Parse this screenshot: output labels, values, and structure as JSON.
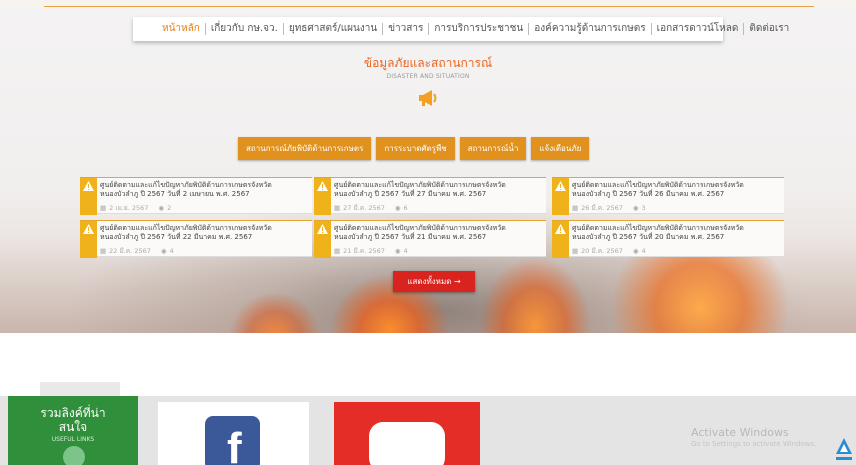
{
  "nav": {
    "items": [
      "หน้าหลัก",
      "เกี่ยวกับ กษ.จว.",
      "ยุทธศาสตร์/แผนงาน",
      "ข่าวสาร",
      "การบริการประชาชน",
      "องค์ความรู้ด้านการเกษตร",
      "เอกสารดาวน์โหลด",
      "ติดต่อเรา"
    ]
  },
  "section": {
    "title": "ข้อมูลภัยและสถานการณ์",
    "subtitle": "DISASTER AND SITUATION"
  },
  "tabs": [
    "สถานการณ์ภัยพิบัติด้านการเกษตร",
    "การระบาดศัตรูพืช",
    "สถานการณ์น้ำ",
    "แจ้งเตือนภัย"
  ],
  "cards": [
    {
      "line1": "ศูนย์ติดตามและแก้ไขปัญหาภัยพิบัติด้านการเกษตรจังหวัด",
      "line2": "หนองบัวลำภู ปี 2567 วันที่ 2 เมษายน พ.ศ. 2567",
      "date": "2 เม.ย. 2567",
      "views": "2"
    },
    {
      "line1": "ศูนย์ติดตามและแก้ไขปัญหาภัยพิบัติด้านการเกษตรจังหวัด",
      "line2": "หนองบัวลำภู ปี 2567 วันที่ 27 มีนาคม พ.ศ. 2567",
      "date": "27 มี.ค. 2567",
      "views": "6"
    },
    {
      "line1": "ศูนย์ติดตามและแก้ไขปัญหาภัยพิบัติด้านการเกษตรจังหวัด",
      "line2": "หนองบัวลำภู ปี 2567 วันที่ 26 มีนาคม พ.ศ. 2567",
      "date": "26 มี.ค. 2567",
      "views": "3"
    },
    {
      "line1": "ศูนย์ติดตามและแก้ไขปัญหาภัยพิบัติด้านการเกษตรจังหวัด",
      "line2": "หนองบัวลำภู ปี 2567 วันที่ 22 มีนาคม พ.ศ. 2567",
      "date": "22 มี.ค. 2567",
      "views": "4"
    },
    {
      "line1": "ศูนย์ติดตามและแก้ไขปัญหาภัยพิบัติด้านการเกษตรจังหวัด",
      "line2": "หนองบัวลำภู ปี 2567 วันที่ 21 มีนาคม พ.ศ. 2567",
      "date": "21 มี.ค. 2567",
      "views": "4"
    },
    {
      "line1": "ศูนย์ติดตามและแก้ไขปัญหาภัยพิบัติด้านการเกษตรจังหวัด",
      "line2": "หนองบัวลำภู ปี 2567 วันที่ 20 มีนาคม พ.ศ. 2567",
      "date": "20 มี.ค. 2567",
      "views": "4"
    }
  ],
  "show_all": "แสดงทั้งหมด →",
  "links": {
    "title_line1": "รวมลิงค์ที่น่า",
    "title_line2": "สนใจ",
    "subtitle": "USEFUL LINKS"
  },
  "facebook_letter": "f",
  "windows": {
    "title": "Activate Windows",
    "subtitle": "Go to Settings to activate Windows."
  },
  "colors": {
    "accent_orange": "#e0911e",
    "title_orange": "#e9651e",
    "warning_yellow": "#f0b21a",
    "button_red": "#d9231f",
    "links_green": "#2f8f3a",
    "facebook_blue": "#3b5998",
    "youtube_red": "#e52d27"
  },
  "icons": {
    "megaphone": "megaphone-icon",
    "warning": "warning-triangle-icon",
    "calendar": "calendar-icon",
    "views": "eye-icon",
    "globe": "globe-icon",
    "facebook": "facebook-icon",
    "youtube": "youtube-icon"
  }
}
